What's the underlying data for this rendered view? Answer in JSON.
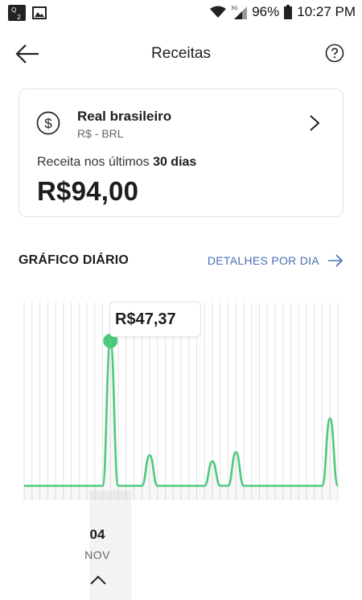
{
  "status_bar": {
    "battery": "96%",
    "time": "10:27 PM",
    "network": "3G"
  },
  "header": {
    "title": "Receitas"
  },
  "currency": {
    "name": "Real brasileiro",
    "code": "R$ - BRL",
    "revenue_label_prefix": "Receita nos últimos ",
    "revenue_label_period": "30 dias",
    "revenue_value": "R$94,00"
  },
  "daily_chart": {
    "title": "GRÁFICO DIÁRIO",
    "details_link": "DETALHES POR DIA",
    "tooltip_value": "R$47,37",
    "selected_day": "04",
    "selected_month": "NOV",
    "accent_color": "#4cca7c"
  },
  "chart_data": {
    "type": "line",
    "series": [
      {
        "values": [
          0,
          0,
          0,
          0,
          0,
          0,
          0,
          0,
          0,
          0,
          0,
          47.37,
          0,
          0,
          0,
          0,
          10,
          0,
          0,
          0,
          0,
          0,
          0,
          0,
          8,
          0,
          0,
          11,
          0,
          0,
          0,
          0,
          0,
          0,
          0,
          0,
          0,
          0,
          0,
          22,
          0
        ]
      }
    ],
    "selected_index": 11,
    "grid": true,
    "ylim": [
      0,
      50
    ]
  }
}
